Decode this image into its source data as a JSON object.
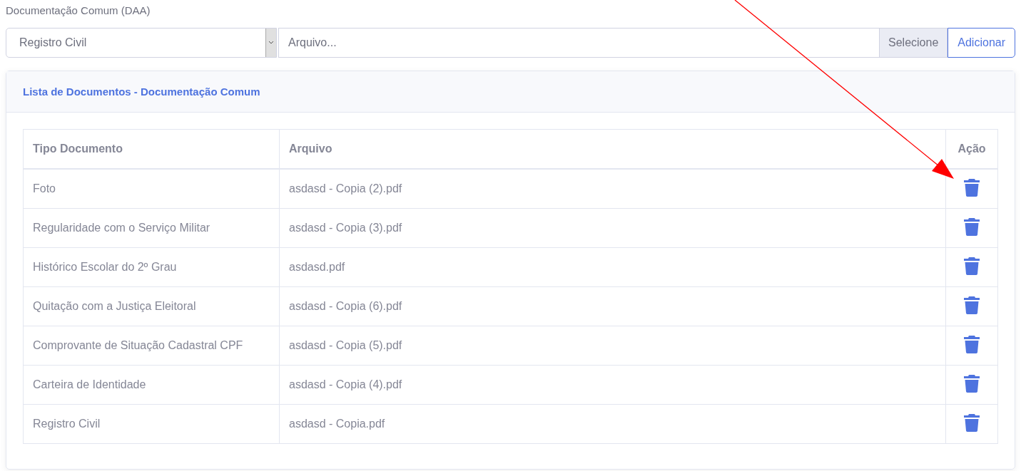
{
  "section_label": "Documentação Comum (DAA)",
  "document_type_select": {
    "value": "Registro Civil"
  },
  "file_field": {
    "placeholder": "Arquivo...",
    "browse_label": "Selecione"
  },
  "add_button": "Adicionar",
  "card": {
    "title": "Lista de Documentos - Documentação Comum"
  },
  "table": {
    "columns": [
      "Tipo Documento",
      "Arquivo",
      "Ação"
    ],
    "rows": [
      {
        "type": "Foto",
        "file": "asdasd - Copia (2).pdf"
      },
      {
        "type": "Regularidade com o Serviço Militar",
        "file": "asdasd - Copia (3).pdf"
      },
      {
        "type": "Histórico Escolar do 2º Grau",
        "file": "asdasd.pdf"
      },
      {
        "type": "Quitação com a Justiça Eleitoral",
        "file": "asdasd - Copia (6).pdf"
      },
      {
        "type": "Comprovante de Situação Cadastral CPF",
        "file": "asdasd - Copia (5).pdf"
      },
      {
        "type": "Carteira de Identidade",
        "file": "asdasd - Copia (4).pdf"
      },
      {
        "type": "Registro Civil",
        "file": "asdasd - Copia.pdf"
      }
    ]
  },
  "annotation": {
    "kind": "arrow"
  }
}
